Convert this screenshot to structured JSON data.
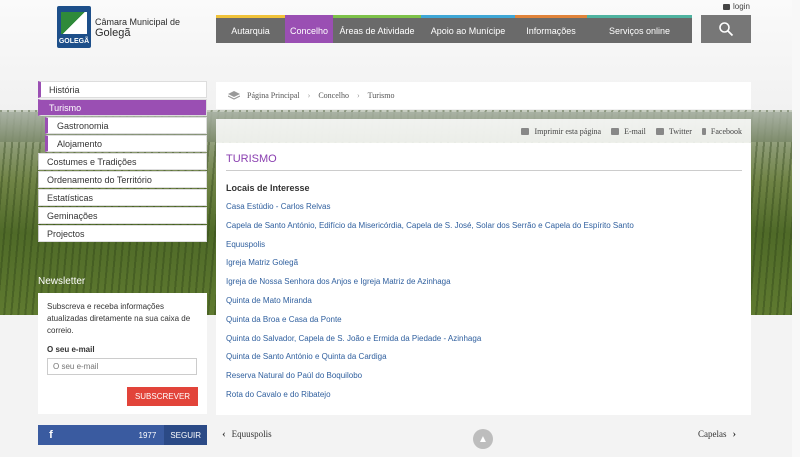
{
  "header": {
    "site_title_line1": "Câmara Municipal de",
    "site_title_line2": "Golegã",
    "logo_word": "GOLEGÃ",
    "login_label": "login"
  },
  "topnav": {
    "items": [
      {
        "label": "Autarquia",
        "color": "#f0c23a"
      },
      {
        "label": "Concelho",
        "color": "#9a4fb3"
      },
      {
        "label": "Áreas de Atividade",
        "color": "#7ec24a"
      },
      {
        "label": "Apoio ao Munícipe",
        "color": "#3fa7d6"
      },
      {
        "label": "Informações",
        "color": "#e0833a"
      },
      {
        "label": "Serviços online",
        "color": "#4fb3a0"
      }
    ],
    "search_icon": "search-icon"
  },
  "sidebar": {
    "items": [
      {
        "label": "História"
      },
      {
        "label": "Turismo"
      },
      {
        "label": "Gastronomia"
      },
      {
        "label": "Alojamento"
      },
      {
        "label": "Costumes e Tradições"
      },
      {
        "label": "Ordenamento do Território"
      },
      {
        "label": "Estatísticas"
      },
      {
        "label": "Geminações"
      },
      {
        "label": "Projectos"
      }
    ]
  },
  "newsletter": {
    "title": "Newsletter",
    "text": "Subscreva e receba informações atualizadas diretamente na sua caixa de correio.",
    "email_label": "O seu e-mail",
    "email_placeholder": "O seu e-mail",
    "button_label": "SUBSCREVER"
  },
  "facebook": {
    "icon": "f",
    "count": "1977",
    "follow_label": "SEGUIR"
  },
  "breadcrumb": {
    "home": "Página Principal",
    "level1": "Concelho",
    "current": "Turismo"
  },
  "tools": {
    "print": "Imprimir esta página",
    "email": "E-mail",
    "twitter": "Twitter",
    "facebook": "Facebook"
  },
  "content": {
    "page_title": "TURISMO",
    "section_heading": "Locais de Interesse",
    "links": [
      "Casa Estúdio - Carlos Relvas",
      "Capela de Santo António, Edifício da Misericórdia, Capela de S. José, Solar dos Serrão e Capela do Espírito Santo",
      "Equuspolis",
      "Igreja Matriz Golegã",
      "Igreja de Nossa Senhora dos Anjos  e Igreja Matriz de Azinhaga",
      "Quinta de Mato Miranda",
      "Quinta da Broa e Casa da Ponte",
      "Quinta do Salvador, Capela de S. João e Ermida da Piedade - Azinhaga",
      "Quinta de Santo António e Quinta da Cardiga",
      "Reserva Natural do Paúl do Boquilobo",
      "Rota do Cavalo  e do Ribatejo"
    ]
  },
  "bottom_nav": {
    "prev_label": "Equuspolis",
    "next_label": "Capelas"
  }
}
